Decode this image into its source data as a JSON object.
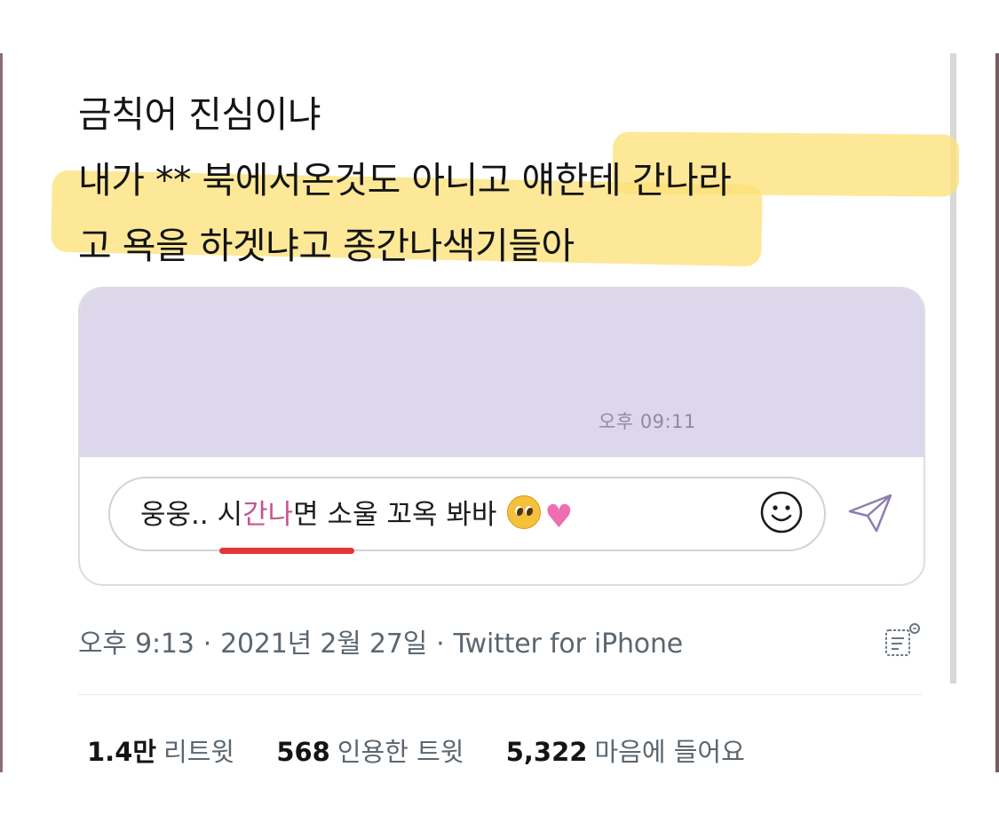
{
  "tweet": {
    "lines": [
      "금칙어 진심이냐",
      "내가 ** 북에서온것도 아니고 얘한테 간나라",
      "고 욕을 하겟냐고 종간나색기들아"
    ]
  },
  "chat_screenshot": {
    "timestamp": "오후 09:11",
    "message_before": "웅웅.. 시",
    "message_highlight": "간나",
    "message_after": "면 소울 꼬옥 봐바",
    "emojis": [
      "pleading-face",
      "pink-heart"
    ]
  },
  "meta": {
    "time": "오후 9:13",
    "date": "2021년 2월 27일",
    "source": "Twitter for iPhone",
    "separator": "·"
  },
  "stats": {
    "retweets_count": "1.4만",
    "retweets_label": "리트윗",
    "quotes_count": "568",
    "quotes_label": "인용한 트윗",
    "likes_count": "5,322",
    "likes_label": "마음에 들어요"
  },
  "colors": {
    "highlight": "#fbe27a",
    "chat_background": "#ddd7ec",
    "highlight_text": "#c7548f",
    "underline": "#e53636"
  }
}
